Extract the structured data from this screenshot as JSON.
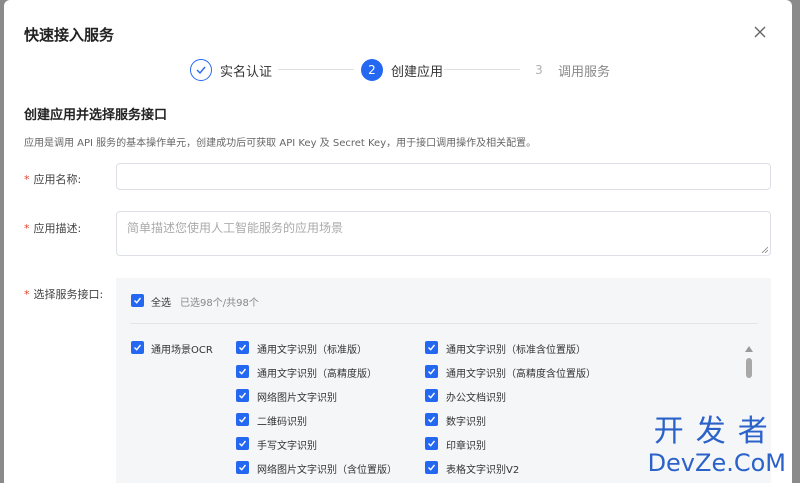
{
  "modal": {
    "title": "快速接入服务"
  },
  "steps": [
    {
      "number": "1",
      "label": "实名认证",
      "state": "done"
    },
    {
      "number": "2",
      "label": "创建应用",
      "state": "active"
    },
    {
      "number": "3",
      "label": "调用服务",
      "state": "todo"
    }
  ],
  "section": {
    "title": "创建应用并选择服务接口",
    "description": "应用是调用 API 服务的基本操作单元，创建成功后可获取 API Key 及 Secret Key，用于接口调用操作及相关配置。"
  },
  "form": {
    "app_name_label": "应用名称:",
    "app_name_value": "",
    "app_desc_label": "应用描述:",
    "app_desc_placeholder": "简单描述您使用人工智能服务的应用场景",
    "service_label": "选择服务接口:"
  },
  "services": {
    "select_all_label": "全选",
    "selected_count": "已选98个/共98个",
    "category": "通用场景OCR",
    "col1": [
      "通用文字识别（标准版）",
      "通用文字识别（高精度版）",
      "网络图片文字识别",
      "二维码识别",
      "手写文字识别",
      "网络图片文字识别（含位置版）"
    ],
    "col2": [
      "通用文字识别（标准含位置版）",
      "通用文字识别（高精度含位置版）",
      "办公文档识别",
      "数字识别",
      "印章识别",
      "表格文字识别V2"
    ]
  },
  "watermark": {
    "top": "开发者",
    "bottom": "DevZe.CoM"
  },
  "colors": {
    "accent": "#2468f2",
    "required": "#e0412b"
  }
}
